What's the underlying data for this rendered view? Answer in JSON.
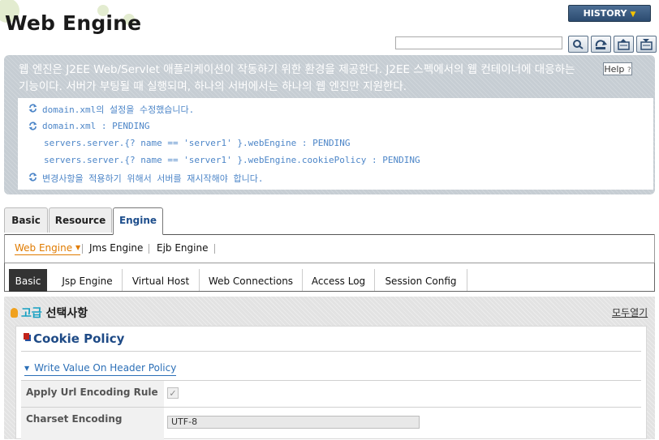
{
  "header": {
    "title": "Web Engine",
    "history_label": "HISTORY",
    "search": {
      "value": "",
      "placeholder": ""
    },
    "tool_icons": [
      "search-icon",
      "refresh-icon",
      "export-icon",
      "import-icon"
    ]
  },
  "info": {
    "description": "웹 엔진은 J2EE Web/Servlet 애플리케이션이 작동하기 위한 환경을 제공한다. J2EE 스펙에서의 웹 컨테이너에 대응하는 기능이다. 서버가 부팅될 때 실행되며, 하나의 서버에서는 하나의 웹 엔진만 지원한다.",
    "help_label": "Help",
    "messages": [
      "domain.xml의 설정을 수정했습니다.",
      "domain.xml : PENDING",
      "servers.server.{? name == 'server1' }.webEngine : PENDING",
      "servers.server.{? name == 'server1' }.webEngine.cookiePolicy : PENDING",
      "변경사항을 적용하기 위해서 서버를 재시작해야 합니다."
    ]
  },
  "tabs1": [
    "Basic",
    "Resource",
    "Engine"
  ],
  "subnav": [
    "Web Engine",
    "Jms Engine",
    "Ejb Engine"
  ],
  "tabs2": [
    "Basic",
    "Jsp Engine",
    "Virtual Host",
    "Web Connections",
    "Access Log",
    "Session Config"
  ],
  "advanced": {
    "title_highlight": "고급",
    "title_rest": " 선택사항",
    "expand_all": "모두열기",
    "section_title": "Cookie Policy",
    "subsection_title": "Write Value On Header Policy",
    "fields": {
      "apply_url_label": "Apply Url Encoding Rule",
      "apply_url_checked": true,
      "charset_label": "Charset Encoding",
      "charset_value": "UTF-8"
    }
  },
  "colors": {
    "accent_blue": "#1e4a86",
    "message_blue": "#4d86c8",
    "active_orange": "#e07b00",
    "info_bg": "#c6cdd3"
  }
}
